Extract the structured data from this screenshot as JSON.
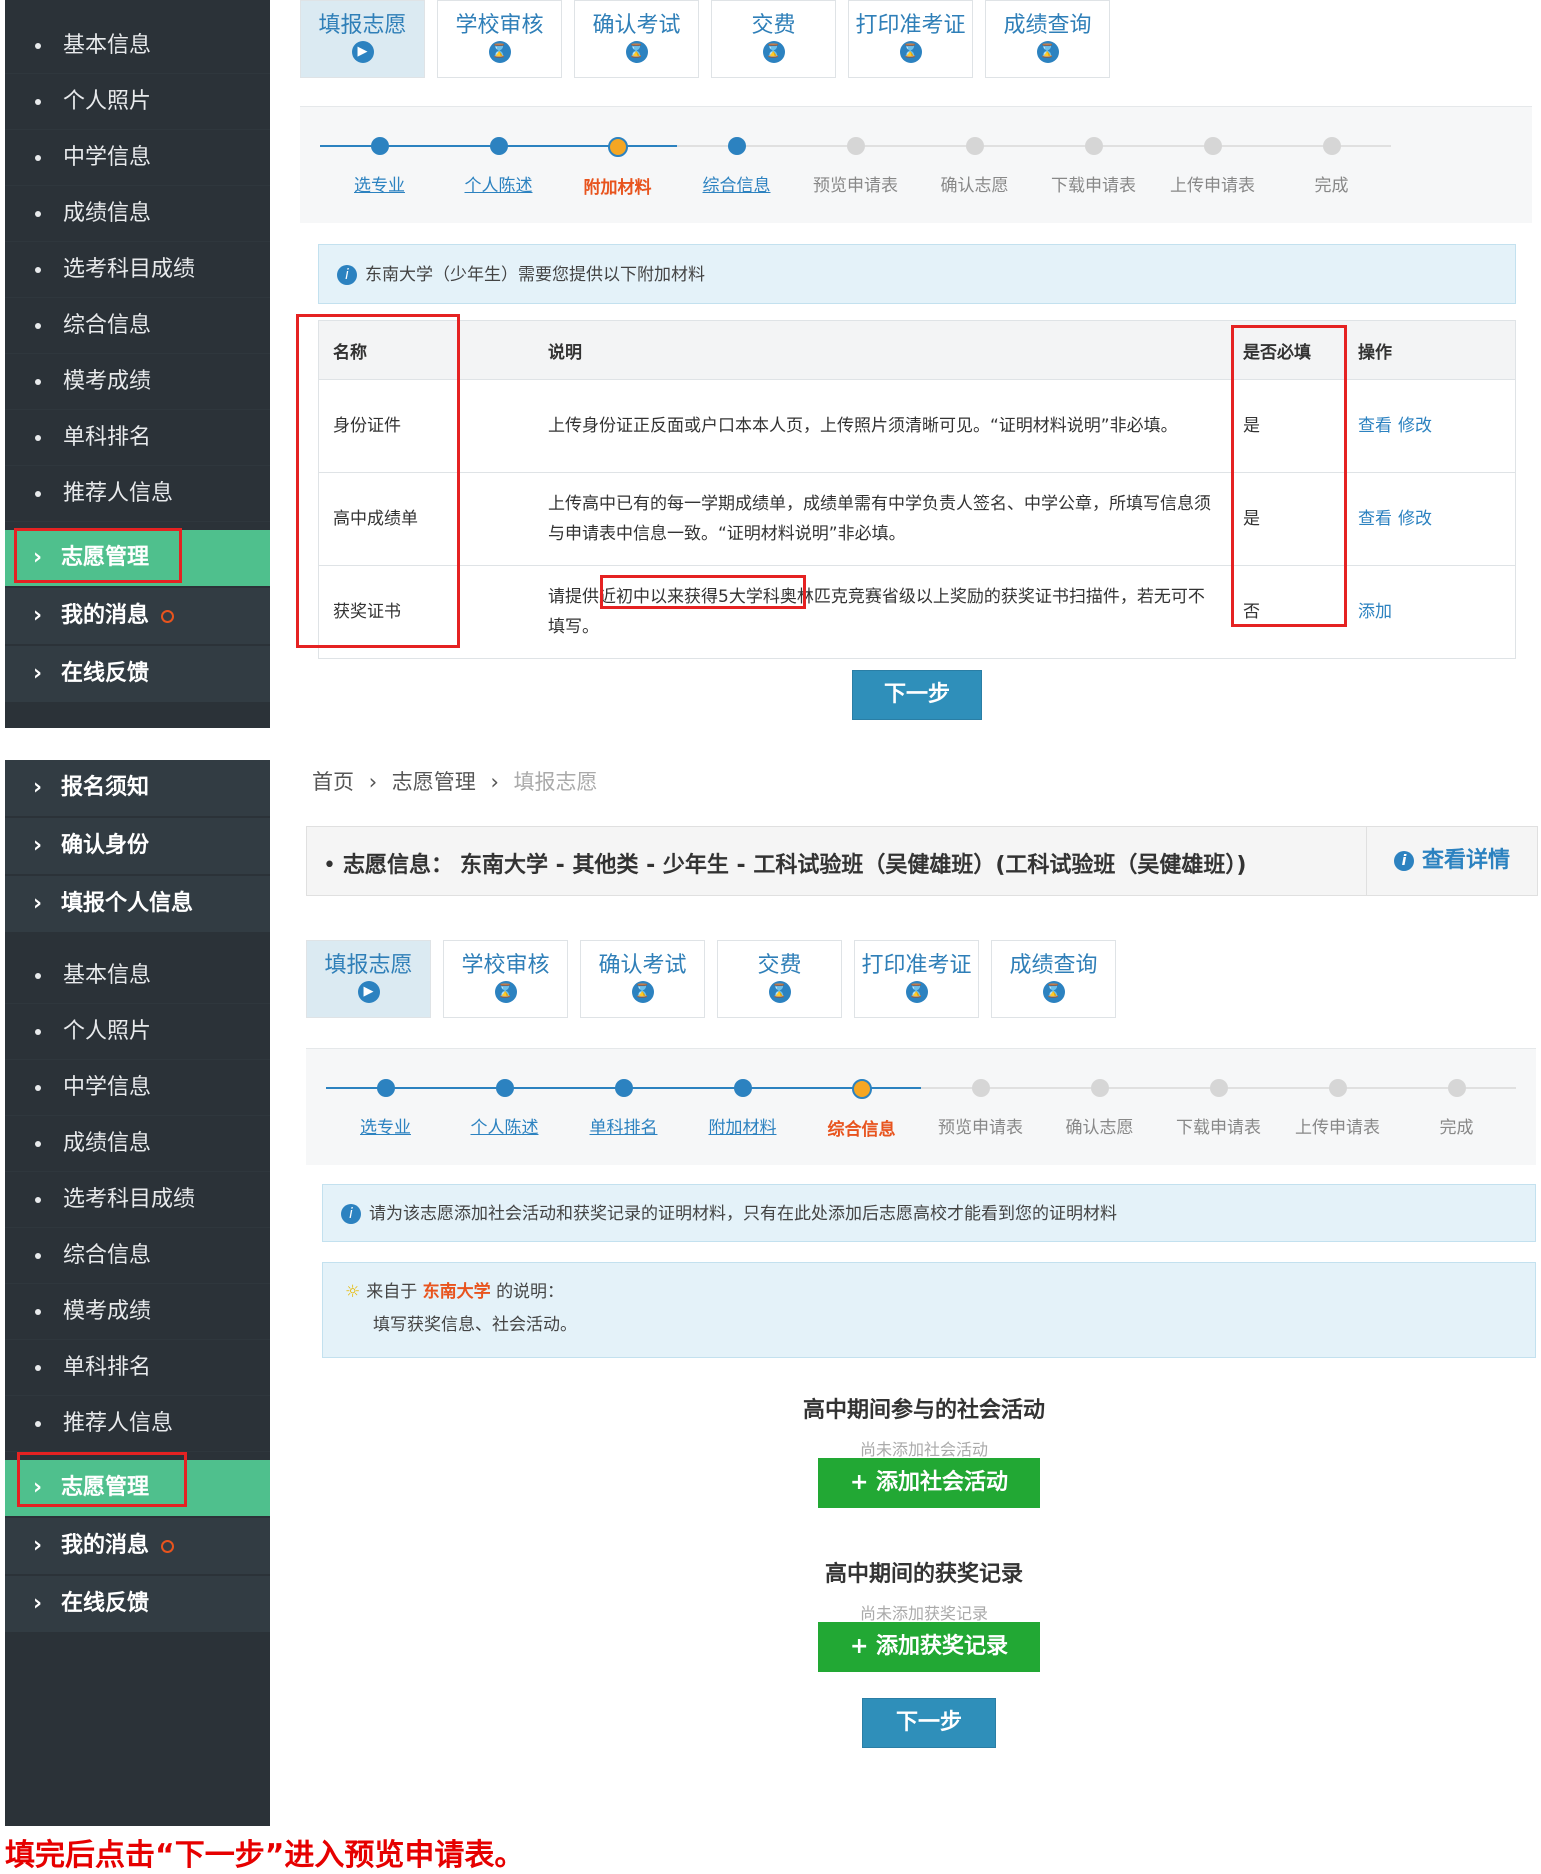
{
  "panel1": {
    "sidebar": {
      "sub_items": [
        "基本信息",
        "个人照片",
        "中学信息",
        "成绩信息",
        "选考科目成绩",
        "综合信息",
        "模考成绩",
        "单科排名",
        "推荐人信息"
      ],
      "main_items": [
        {
          "label": "志愿管理",
          "active": true
        },
        {
          "label": "我的消息",
          "badge": true
        },
        {
          "label": "在线反馈"
        }
      ]
    },
    "tabs": [
      "填报志愿",
      "学校审核",
      "确认考试",
      "交费",
      "打印准考证",
      "成绩查询"
    ],
    "steps": [
      {
        "label": "选专业",
        "state": "done"
      },
      {
        "label": "个人陈述",
        "state": "done"
      },
      {
        "label": "附加材料",
        "state": "current"
      },
      {
        "label": "综合信息",
        "state": "done"
      },
      {
        "label": "预览申请表",
        "state": "todo"
      },
      {
        "label": "确认志愿",
        "state": "todo"
      },
      {
        "label": "下载申请表",
        "state": "todo"
      },
      {
        "label": "上传申请表",
        "state": "todo"
      },
      {
        "label": "完成",
        "state": "todo"
      }
    ],
    "info": "东南大学（少年生）需要您提供以下附加材料",
    "table": {
      "headers": [
        "名称",
        "说明",
        "是否必填",
        "操作"
      ],
      "rows": [
        {
          "name": "身份证件",
          "desc": "上传身份证正反面或户口本本人页，上传照片须清晰可见。“证明材料说明”非必填。",
          "required": "是",
          "ops": [
            "查看",
            "修改"
          ]
        },
        {
          "name": "高中成绩单",
          "desc": "上传高中已有的每一学期成绩单，成绩单需有中学负责人签名、中学公章，所填写信息须与申请表中信息一致。“证明材料说明”非必填。",
          "required": "是",
          "ops": [
            "查看",
            "修改"
          ]
        },
        {
          "name": "获奖证书",
          "desc": "请提供近初中以来获得5大学科奥林匹克竞赛省级以上奖励的获奖证书扫描件，若无可不填写。",
          "required": "否",
          "ops": [
            "添加"
          ]
        }
      ]
    },
    "next": "下一步"
  },
  "panel2": {
    "sidebar": {
      "top_items": [
        "报名须知",
        "确认身份",
        "填报个人信息"
      ],
      "sub_items": [
        "基本信息",
        "个人照片",
        "中学信息",
        "成绩信息",
        "选考科目成绩",
        "综合信息",
        "模考成绩",
        "单科排名",
        "推荐人信息"
      ],
      "main_items": [
        {
          "label": "志愿管理",
          "active": true
        },
        {
          "label": "我的消息",
          "badge": true
        },
        {
          "label": "在线反馈"
        }
      ]
    },
    "breadcrumb": [
      "首页",
      "志愿管理",
      "填报志愿"
    ],
    "intent_label": "志愿信息：",
    "intent_value": "东南大学 - 其他类 - 少年生 - 工科试验班（吴健雄班）(工科试验班（吴健雄班）)",
    "details_link": "查看详情",
    "tabs": [
      "填报志愿",
      "学校审核",
      "确认考试",
      "交费",
      "打印准考证",
      "成绩查询"
    ],
    "steps": [
      {
        "label": "选专业",
        "state": "done"
      },
      {
        "label": "个人陈述",
        "state": "done"
      },
      {
        "label": "单科排名",
        "state": "done"
      },
      {
        "label": "附加材料",
        "state": "done"
      },
      {
        "label": "综合信息",
        "state": "current"
      },
      {
        "label": "预览申请表",
        "state": "todo"
      },
      {
        "label": "确认志愿",
        "state": "todo"
      },
      {
        "label": "下载申请表",
        "state": "todo"
      },
      {
        "label": "上传申请表",
        "state": "todo"
      },
      {
        "label": "完成",
        "state": "todo"
      }
    ],
    "info": "请为该志愿添加社会活动和获奖记录的证明材料，只有在此处添加后志愿高校才能看到您的证明材料",
    "note_prefix": "来自于",
    "note_school": "东南大学",
    "note_suffix": "的说明：",
    "note_body": "填写获奖信息、社会活动。",
    "activities_title": "高中期间参与的社会活动",
    "activities_empty": "尚未添加社会活动",
    "add_activity": "+ 添加社会活动",
    "awards_title": "高中期间的获奖记录",
    "awards_empty": "尚未添加获奖记录",
    "add_award": "+ 添加获奖记录",
    "next": "下一步"
  },
  "caption": "填完后点击“下一步”进入预览申请表。"
}
